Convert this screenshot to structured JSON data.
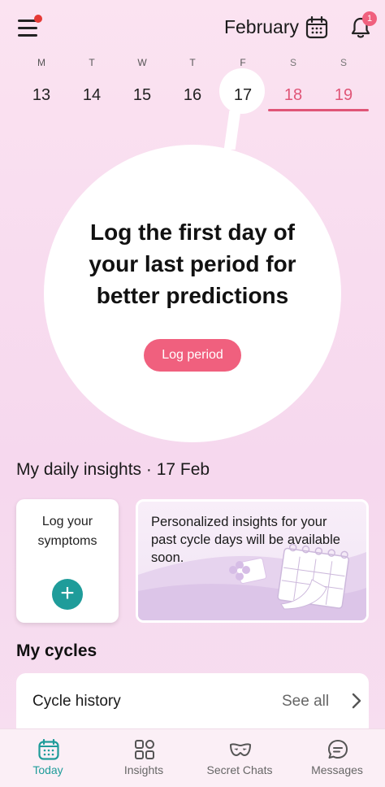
{
  "header": {
    "month": "February",
    "notification_count": "1"
  },
  "week": [
    {
      "letter": "M",
      "number": "13"
    },
    {
      "letter": "T",
      "number": "14"
    },
    {
      "letter": "W",
      "number": "15"
    },
    {
      "letter": "T",
      "number": "16"
    },
    {
      "letter": "F",
      "number": "17"
    },
    {
      "letter": "S",
      "number": "18"
    },
    {
      "letter": "S",
      "number": "19"
    }
  ],
  "main": {
    "title": "Log the first day of your last period for better predictions",
    "log_button": "Log period"
  },
  "insights": {
    "title": "My daily insights · 17 Feb",
    "log_card": "Log your symptoms",
    "personalized_card": "Personalized insights for your past cycle days will be available soon."
  },
  "cycles": {
    "title": "My cycles",
    "history_label": "Cycle history",
    "see_all": "See all"
  },
  "nav": [
    {
      "label": "Today"
    },
    {
      "label": "Insights"
    },
    {
      "label": "Secret Chats"
    },
    {
      "label": "Messages"
    }
  ],
  "colors": {
    "accent": "#f0607e",
    "teal": "#1f9c9a",
    "weekend": "#e05577"
  }
}
